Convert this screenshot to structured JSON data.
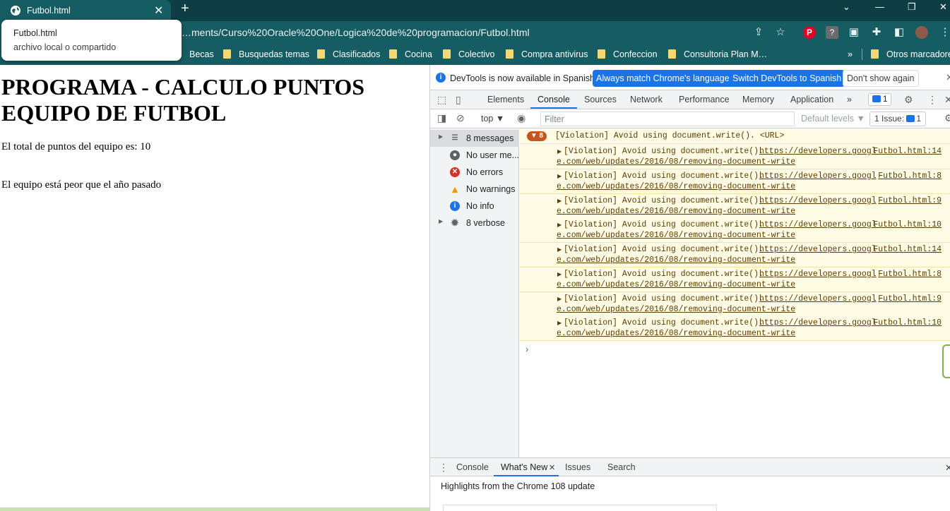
{
  "browser": {
    "tab_title": "Futbol.html",
    "tab_close": "✕",
    "new_tab": "+",
    "url": "…ments/Curso%20Oracle%20One/Logica%20de%20programacion/Futbol.html",
    "window_controls": {
      "chevron": "⌄",
      "minimize": "—",
      "restore": "❐",
      "close": "✕"
    },
    "toolbar_icons": [
      "share-icon",
      "star-icon",
      "pinterest-icon",
      "help-icon",
      "media-icon",
      "extensions-icon",
      "sidepanel-icon",
      "avatar",
      "menu-icon"
    ],
    "popup": {
      "title": "Futbol.html",
      "subtitle": "archivo local o compartido"
    },
    "bookmarks": [
      "Becas",
      "Busquedas temas",
      "Clasificados",
      "Cocina",
      "Colectivo",
      "Compra antivirus",
      "Confeccion",
      "Consultoria Plan M…"
    ],
    "bookmarks_more": "»",
    "other_bookmarks": "Otros marcadores"
  },
  "page": {
    "heading": "PROGRAMA - CALCULO PUNTOS EQUIPO DE FUTBOL",
    "line1": "El total de puntos del equipo es: 10",
    "line2": "El equipo está peor que el año pasado"
  },
  "devtools": {
    "infobar": {
      "text": "DevTools is now available in Spanish!",
      "btn_match": "Always match Chrome's language",
      "btn_switch": "Switch DevTools to Spanish",
      "btn_dont": "Don't show again",
      "close": "✕"
    },
    "tabs": [
      "Elements",
      "Console",
      "Sources",
      "Network",
      "Performance",
      "Memory",
      "Application"
    ],
    "tabs_more": "»",
    "issues_badge": "1",
    "filter": {
      "context": "top ▼",
      "placeholder": "Filter",
      "levels": "Default levels ▼",
      "issue_button": "1 Issue:",
      "issue_count": "1"
    },
    "sidebar": {
      "messages": "8 messages",
      "user": "No user me...",
      "errors": "No errors",
      "warnings": "No warnings",
      "info": "No info",
      "verbose": "8 verbose"
    },
    "console": {
      "group_count": "▼ 8",
      "group_text": "[Violation] Avoid using document.write(). <URL>",
      "messages": [
        {
          "text": "[Violation] Avoid using document.write().",
          "link_a": "https://developers.googl",
          "link_b": "e.com/web/updates/2016/08/removing-document-write",
          "source": "Futbol.html:14"
        },
        {
          "text": "[Violation] Avoid using document.write().",
          "link_a": "https://developers.googl",
          "link_b": "e.com/web/updates/2016/08/removing-document-write",
          "source": "Futbol.html:8"
        },
        {
          "text": "[Violation] Avoid using document.write().",
          "link_a": "https://developers.googl",
          "link_b": "e.com/web/updates/2016/08/removing-document-write",
          "source": "Futbol.html:9"
        },
        {
          "text": "[Violation] Avoid using document.write().",
          "link_a": "https://developers.googl",
          "link_b": "e.com/web/updates/2016/08/removing-document-write",
          "source": "Futbol.html:10"
        },
        {
          "text": "[Violation] Avoid using document.write().",
          "link_a": "https://developers.googl",
          "link_b": "e.com/web/updates/2016/08/removing-document-write",
          "source": "Futbol.html:14"
        },
        {
          "text": "[Violation] Avoid using document.write().",
          "link_a": "https://developers.googl",
          "link_b": "e.com/web/updates/2016/08/removing-document-write",
          "source": "Futbol.html:8"
        },
        {
          "text": "[Violation] Avoid using document.write().",
          "link_a": "https://developers.googl",
          "link_b": "e.com/web/updates/2016/08/removing-document-write",
          "source": "Futbol.html:9"
        },
        {
          "text": "[Violation] Avoid using document.write().",
          "link_a": "https://developers.googl",
          "link_b": "e.com/web/updates/2016/08/removing-document-write",
          "source": "Futbol.html:10"
        }
      ],
      "prompt": "›"
    },
    "drawer": {
      "tabs": [
        "Console",
        "What's New",
        "Issues",
        "Search"
      ],
      "whats_new_close": "✕",
      "close": "✕",
      "highlights": "Highlights from the Chrome 108 update"
    }
  }
}
